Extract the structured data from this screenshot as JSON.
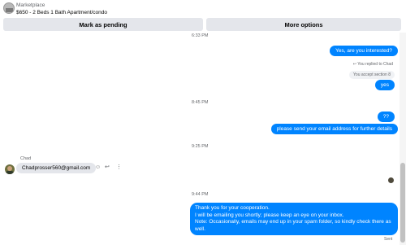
{
  "header": {
    "category": "Marketplace",
    "listing_title": "$650 - 2 Beds 1 Bath Apartment/condo",
    "mark_pending_label": "Mark as pending",
    "more_options_label": "More options"
  },
  "messages": {
    "ts1": "6:33 PM",
    "msg_interested": "Yes, are you interested?",
    "reply_label": "You replied to Chad",
    "quoted_text": "You accept section 8",
    "msg_yes": "yes",
    "ts2": "8:45 PM",
    "msg_qq": "??",
    "msg_email_request": "please send your email address for further details",
    "ts3": "9:25 PM",
    "sender_name": "Chad",
    "chad_message": "Chadprosser560@gmail.com",
    "ts4": "9:44 PM",
    "final_line1": "Thank you for your cooperation.",
    "final_line2": "I will be emailing you shortly; please keep an eye on your inbox.",
    "final_line3": "Note: Occasionally, emails may end up in your spam folder, so kindly check there as well.",
    "sent_status": "Sent"
  },
  "icons": {
    "emoji": "☺",
    "reply": "↩",
    "more": "⋮",
    "reply_small": "↩"
  },
  "colors": {
    "outgoing_bubble": "#0084ff",
    "incoming_bubble": "#e4e6eb",
    "button_bg": "#e4e6eb"
  }
}
